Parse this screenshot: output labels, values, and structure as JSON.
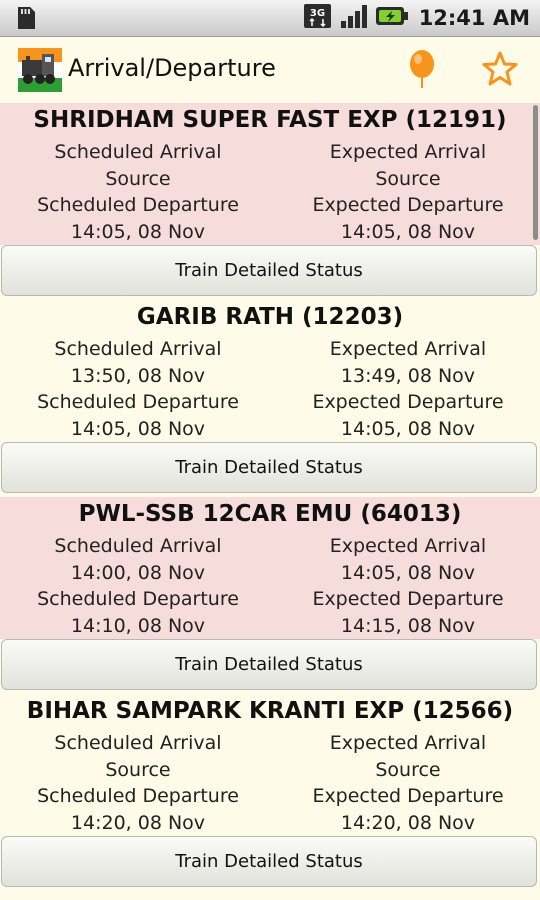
{
  "status_bar": {
    "time": "12:41 AM",
    "network": "3G",
    "icons": [
      "sd-card-icon",
      "network-3g-icon",
      "signal-icon",
      "battery-charging-icon"
    ]
  },
  "action_bar": {
    "title": "Arrival/Departure",
    "icons": [
      "app-logo-icon",
      "location-pin-icon",
      "star-icon"
    ],
    "accent_color": "#f7941d"
  },
  "trains": [
    {
      "name": "SHRIDHAM SUPER FAST EXP (12191)",
      "sched_arrival_label": "Scheduled Arrival",
      "sched_arrival_value": "Source",
      "exp_arrival_label": "Expected Arrival",
      "exp_arrival_value": "Source",
      "sched_departure_label": "Scheduled Departure",
      "sched_departure_value": "14:05, 08 Nov",
      "exp_departure_label": "Expected Departure",
      "exp_departure_value": "14:05, 08 Nov",
      "button_label": "Train Detailed Status",
      "bg": "pink"
    },
    {
      "name": "GARIB RATH (12203)",
      "sched_arrival_label": "Scheduled Arrival",
      "sched_arrival_value": "13:50, 08 Nov",
      "exp_arrival_label": "Expected Arrival",
      "exp_arrival_value": "13:49, 08 Nov",
      "sched_departure_label": "Scheduled Departure",
      "sched_departure_value": "14:05, 08 Nov",
      "exp_departure_label": "Expected Departure",
      "exp_departure_value": "14:05, 08 Nov",
      "button_label": "Train Detailed Status",
      "bg": "cream"
    },
    {
      "name": "PWL-SSB 12CAR EMU (64013)",
      "sched_arrival_label": "Scheduled Arrival",
      "sched_arrival_value": "14:00, 08 Nov",
      "exp_arrival_label": "Expected Arrival",
      "exp_arrival_value": "14:05, 08 Nov",
      "sched_departure_label": "Scheduled Departure",
      "sched_departure_value": "14:10, 08 Nov",
      "exp_departure_label": "Expected Departure",
      "exp_departure_value": "14:15, 08 Nov",
      "button_label": "Train Detailed Status",
      "bg": "pink"
    },
    {
      "name": "BIHAR SAMPARK KRANTI EXP (12566)",
      "sched_arrival_label": "Scheduled Arrival",
      "sched_arrival_value": "Source",
      "exp_arrival_label": "Expected Arrival",
      "exp_arrival_value": "Source",
      "sched_departure_label": "Scheduled Departure",
      "sched_departure_value": "14:20, 08 Nov",
      "exp_departure_label": "Expected Departure",
      "exp_departure_value": "14:20, 08 Nov",
      "button_label": "Train Detailed Status",
      "bg": "cream"
    }
  ]
}
